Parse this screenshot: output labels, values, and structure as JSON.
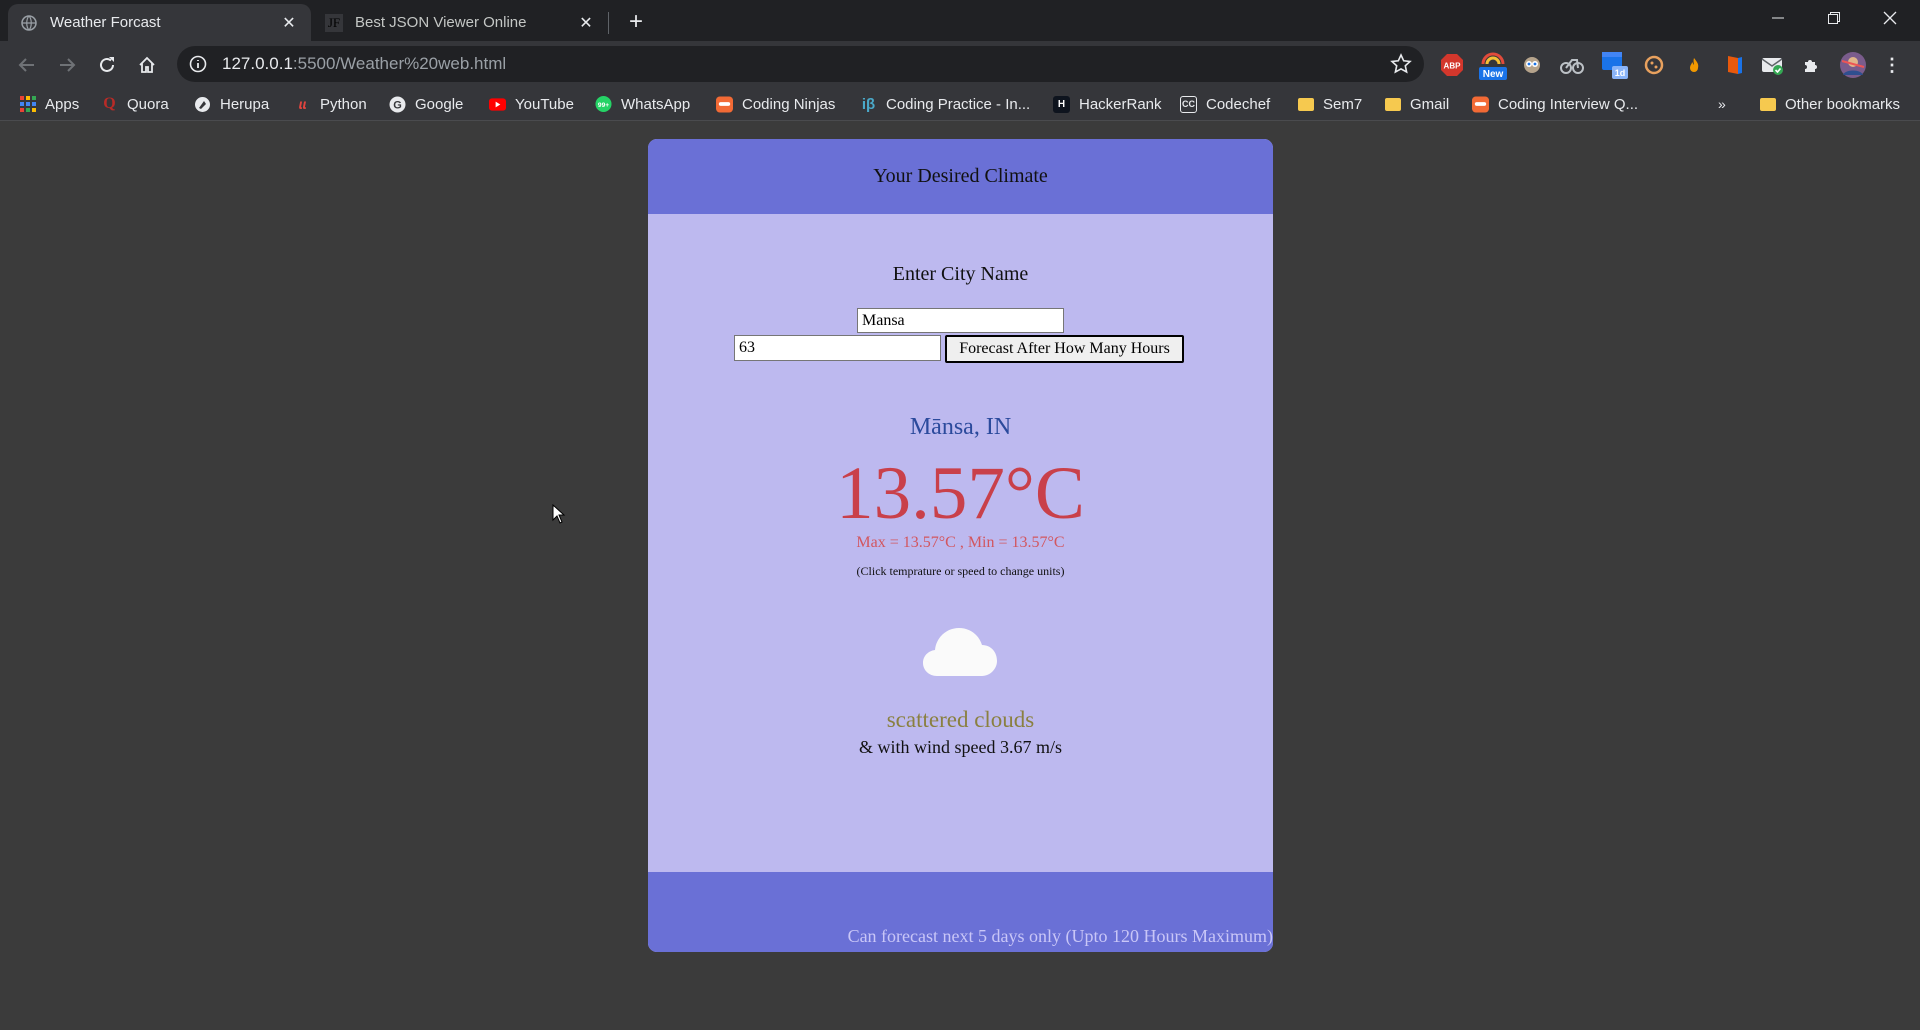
{
  "browser": {
    "tabs": [
      {
        "title": "Weather Forcast",
        "active": true
      },
      {
        "title": "Best JSON Viewer Online",
        "active": false,
        "favicon_text": "JF"
      }
    ],
    "url": {
      "host": "127.0.0.1",
      "path": ":5500/Weather%20web.html"
    },
    "bookmarks": [
      {
        "label": "Apps",
        "icon": "apps-grid-icon"
      },
      {
        "label": "Quora",
        "icon": "quora-icon"
      },
      {
        "label": "Herupa",
        "icon": "herupa-icon"
      },
      {
        "label": "Python",
        "icon": "python-icon"
      },
      {
        "label": "Google",
        "icon": "google-icon"
      },
      {
        "label": "YouTube",
        "icon": "youtube-icon"
      },
      {
        "label": "WhatsApp",
        "icon": "whatsapp-icon"
      },
      {
        "label": "Coding Ninjas",
        "icon": "coding-ninjas-icon"
      },
      {
        "label": "Coding Practice - In...",
        "icon": "interviewbit-icon"
      },
      {
        "label": "HackerRank",
        "icon": "hackerrank-icon"
      },
      {
        "label": "Codechef",
        "icon": "codechef-icon"
      },
      {
        "label": "Sem7",
        "icon": "folder-icon"
      },
      {
        "label": "Gmail",
        "icon": "folder-icon"
      },
      {
        "label": "Coding Interview Q...",
        "icon": "coding-ninjas-icon"
      }
    ],
    "overflow": "»",
    "other_bookmarks": "Other bookmarks",
    "extensions": {
      "abp": "ABP",
      "new_badge": "New",
      "calendar_badge": "1d"
    },
    "colors": {
      "tabstrip": "#202124",
      "toolbar": "#35363a"
    }
  },
  "page": {
    "header": "Your Desired Climate",
    "enter_city_label": "Enter City Name",
    "city_value": "Mansa",
    "hours_value": "63",
    "forecast_button": "Forecast After How Many Hours",
    "location": "Mānsa, IN",
    "temperature": "13.57°C",
    "minmax": "Max = 13.57°C , Min = 13.57°C",
    "hint": "(Click temprature or speed to change units)",
    "weather_icon": "cloud-icon",
    "description": "scattered clouds",
    "wind": "& with wind speed 3.67 m/s",
    "footer_note": "Can forecast next 5 days only (Upto 120 Hours Maximum)",
    "colors": {
      "header": "#6a70d6",
      "body": "#bdb9ef",
      "temperature": "#c9404a",
      "location": "#2b4a9c",
      "description": "#8a8040"
    }
  }
}
